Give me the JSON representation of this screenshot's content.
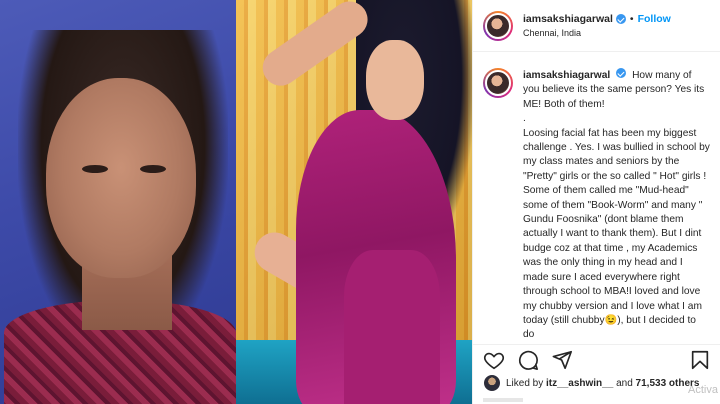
{
  "post": {
    "username": "iamsakshiagarwal",
    "follow_label": "Follow",
    "separator": "•",
    "location": "Chennai, India",
    "more_icon": "•••"
  },
  "caption": {
    "username": "iamsakshiagarwal",
    "paragraph1": "How many of you believe its the same person? Yes its ME! Both of them!",
    "paragraph2": ".",
    "paragraph3": "Loosing facial fat has been my biggest challenge . Yes. I was bullied in school by my class mates and seniors by the \"Pretty\" girls or the so called \" Hot\" girls ! Some of them called me \"Mud-head\" some of them \"Book-Worm\" and many \" Gundu Foosnika\" (dont blame them actually I want to thank them). But I dint budge coz at that time , my Academics was the only thing in my head and I made sure I aced everywhere right through school to MBA!I loved and love my chubby version and I love what I am today (still chubby😉), but I decided to do"
  },
  "likes": {
    "prefix": "Liked by",
    "user": "itz__ashwin__",
    "connector": "and",
    "others": "71,533 others"
  },
  "watermark": "Activa",
  "icons": {
    "verified": "verified-badge-icon",
    "like": "heart-icon",
    "comment": "comment-icon",
    "share": "paper-plane-icon",
    "save": "bookmark-icon"
  },
  "colors": {
    "accent": "#0095f6",
    "verified": "#3897f0",
    "text": "#262626",
    "border": "#efefef"
  }
}
